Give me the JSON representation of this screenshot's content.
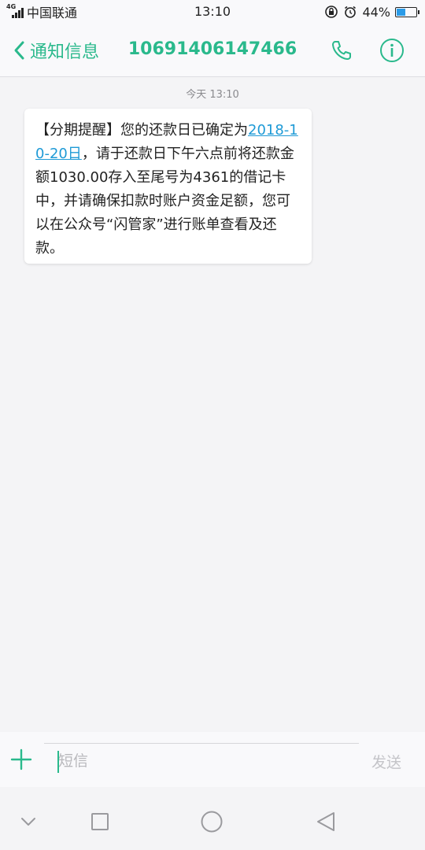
{
  "status_bar": {
    "network_type": "4G",
    "carrier": "中国联通",
    "time": "13:10",
    "battery_percent": "44%",
    "battery_level": 0.44,
    "icons": [
      "signal-icon",
      "rotation-lock-icon",
      "alarm-icon",
      "battery-icon"
    ]
  },
  "header": {
    "back_label": "通知信息",
    "title": "10691406147466",
    "accent_color": "#2ab98c",
    "icons": [
      "back-chevron-icon",
      "phone-icon",
      "info-icon"
    ]
  },
  "conversation": {
    "timestamp": "今天 13:10",
    "messages": [
      {
        "text_before": "【分期提醒】您的还款日已确定为",
        "link": "2018-10-20日",
        "text_after": "，请于还款日下午六点前将还款金额1030.00存入至尾号为4361的借记卡中，并请确保扣款时账户资金足额，您可以在公众号“闪管家”进行账单查看及还款。"
      }
    ],
    "link_color": "#1e9ad6"
  },
  "input_bar": {
    "placeholder": "短信",
    "value": "",
    "send_label": "发送",
    "icons": [
      "plus-icon"
    ]
  },
  "nav_bar": {
    "icons": [
      "chevron-down-icon",
      "recent-apps-icon",
      "home-icon",
      "back-icon"
    ]
  }
}
